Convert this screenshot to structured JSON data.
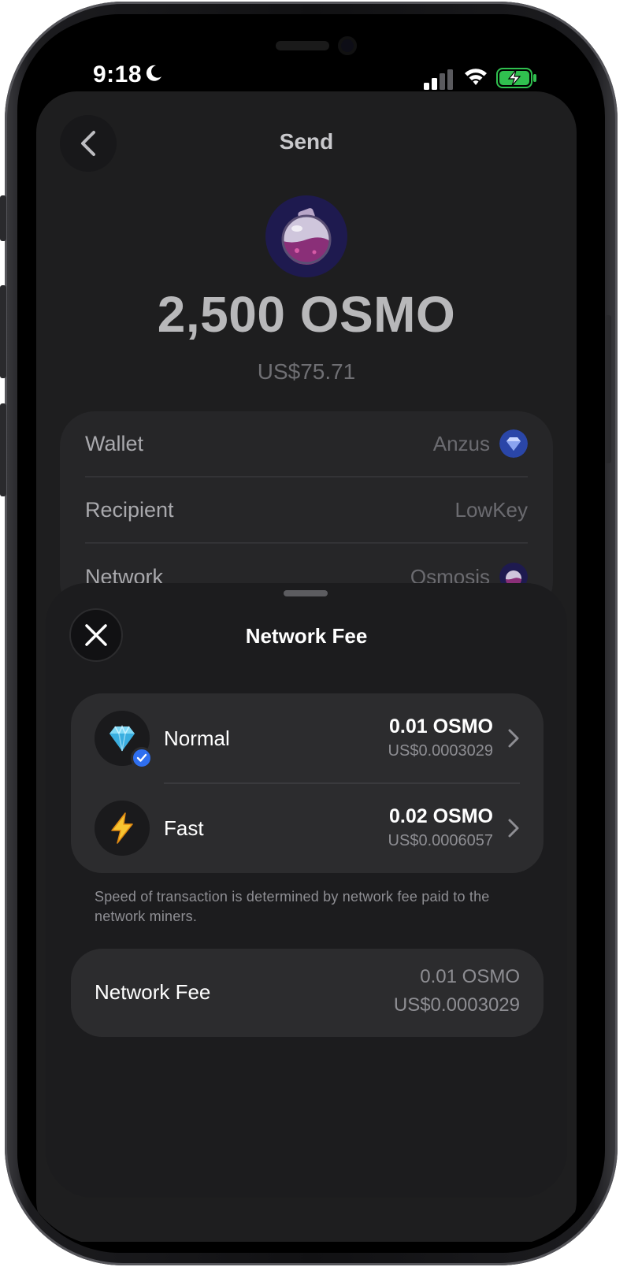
{
  "status_bar": {
    "time": "9:18"
  },
  "send_screen": {
    "title": "Send",
    "token_icon": "osmo-potion-icon",
    "amount": "2,500 OSMO",
    "amount_usd": "US$75.71",
    "details": [
      {
        "label": "Wallet",
        "value": "Anzus",
        "icon": "diamond-wallet-icon"
      },
      {
        "label": "Recipient",
        "value": "LowKey"
      },
      {
        "label": "Network",
        "value": "Osmosis",
        "icon": "osmosis-network-icon"
      }
    ]
  },
  "fee_modal": {
    "title": "Network Fee",
    "options": [
      {
        "name": "Normal",
        "amount": "0.01 OSMO",
        "usd": "US$0.0003029",
        "icon": "gem-icon",
        "selected": true
      },
      {
        "name": "Fast",
        "amount": "0.02 OSMO",
        "usd": "US$0.0006057",
        "icon": "lightning-icon",
        "selected": false
      }
    ],
    "helper_text": "Speed of transaction is determined by network fee paid to the network miners.",
    "summary": {
      "label": "Network Fee",
      "amount": "0.01 OSMO",
      "usd": "US$0.0003029"
    }
  },
  "colors": {
    "accent_blue": "#2f6ff0",
    "sheet_bg": "#1c1c1e",
    "card_bg": "#2c2c2e"
  }
}
